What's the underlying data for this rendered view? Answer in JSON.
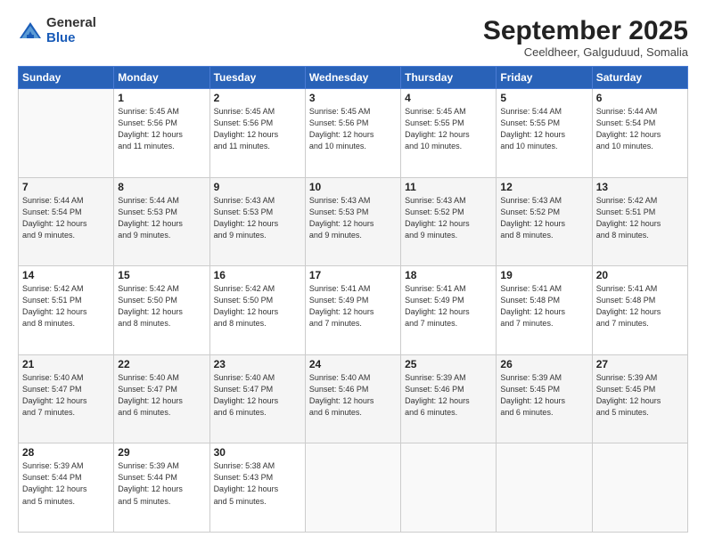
{
  "header": {
    "logo_general": "General",
    "logo_blue": "Blue",
    "month_title": "September 2025",
    "subtitle": "Ceeldheer, Galguduud, Somalia"
  },
  "weekdays": [
    "Sunday",
    "Monday",
    "Tuesday",
    "Wednesday",
    "Thursday",
    "Friday",
    "Saturday"
  ],
  "weeks": [
    [
      {
        "day": "",
        "info": ""
      },
      {
        "day": "1",
        "info": "Sunrise: 5:45 AM\nSunset: 5:56 PM\nDaylight: 12 hours\nand 11 minutes."
      },
      {
        "day": "2",
        "info": "Sunrise: 5:45 AM\nSunset: 5:56 PM\nDaylight: 12 hours\nand 11 minutes."
      },
      {
        "day": "3",
        "info": "Sunrise: 5:45 AM\nSunset: 5:56 PM\nDaylight: 12 hours\nand 10 minutes."
      },
      {
        "day": "4",
        "info": "Sunrise: 5:45 AM\nSunset: 5:55 PM\nDaylight: 12 hours\nand 10 minutes."
      },
      {
        "day": "5",
        "info": "Sunrise: 5:44 AM\nSunset: 5:55 PM\nDaylight: 12 hours\nand 10 minutes."
      },
      {
        "day": "6",
        "info": "Sunrise: 5:44 AM\nSunset: 5:54 PM\nDaylight: 12 hours\nand 10 minutes."
      }
    ],
    [
      {
        "day": "7",
        "info": "Sunrise: 5:44 AM\nSunset: 5:54 PM\nDaylight: 12 hours\nand 9 minutes."
      },
      {
        "day": "8",
        "info": "Sunrise: 5:44 AM\nSunset: 5:53 PM\nDaylight: 12 hours\nand 9 minutes."
      },
      {
        "day": "9",
        "info": "Sunrise: 5:43 AM\nSunset: 5:53 PM\nDaylight: 12 hours\nand 9 minutes."
      },
      {
        "day": "10",
        "info": "Sunrise: 5:43 AM\nSunset: 5:53 PM\nDaylight: 12 hours\nand 9 minutes."
      },
      {
        "day": "11",
        "info": "Sunrise: 5:43 AM\nSunset: 5:52 PM\nDaylight: 12 hours\nand 9 minutes."
      },
      {
        "day": "12",
        "info": "Sunrise: 5:43 AM\nSunset: 5:52 PM\nDaylight: 12 hours\nand 8 minutes."
      },
      {
        "day": "13",
        "info": "Sunrise: 5:42 AM\nSunset: 5:51 PM\nDaylight: 12 hours\nand 8 minutes."
      }
    ],
    [
      {
        "day": "14",
        "info": "Sunrise: 5:42 AM\nSunset: 5:51 PM\nDaylight: 12 hours\nand 8 minutes."
      },
      {
        "day": "15",
        "info": "Sunrise: 5:42 AM\nSunset: 5:50 PM\nDaylight: 12 hours\nand 8 minutes."
      },
      {
        "day": "16",
        "info": "Sunrise: 5:42 AM\nSunset: 5:50 PM\nDaylight: 12 hours\nand 8 minutes."
      },
      {
        "day": "17",
        "info": "Sunrise: 5:41 AM\nSunset: 5:49 PM\nDaylight: 12 hours\nand 7 minutes."
      },
      {
        "day": "18",
        "info": "Sunrise: 5:41 AM\nSunset: 5:49 PM\nDaylight: 12 hours\nand 7 minutes."
      },
      {
        "day": "19",
        "info": "Sunrise: 5:41 AM\nSunset: 5:48 PM\nDaylight: 12 hours\nand 7 minutes."
      },
      {
        "day": "20",
        "info": "Sunrise: 5:41 AM\nSunset: 5:48 PM\nDaylight: 12 hours\nand 7 minutes."
      }
    ],
    [
      {
        "day": "21",
        "info": "Sunrise: 5:40 AM\nSunset: 5:47 PM\nDaylight: 12 hours\nand 7 minutes."
      },
      {
        "day": "22",
        "info": "Sunrise: 5:40 AM\nSunset: 5:47 PM\nDaylight: 12 hours\nand 6 minutes."
      },
      {
        "day": "23",
        "info": "Sunrise: 5:40 AM\nSunset: 5:47 PM\nDaylight: 12 hours\nand 6 minutes."
      },
      {
        "day": "24",
        "info": "Sunrise: 5:40 AM\nSunset: 5:46 PM\nDaylight: 12 hours\nand 6 minutes."
      },
      {
        "day": "25",
        "info": "Sunrise: 5:39 AM\nSunset: 5:46 PM\nDaylight: 12 hours\nand 6 minutes."
      },
      {
        "day": "26",
        "info": "Sunrise: 5:39 AM\nSunset: 5:45 PM\nDaylight: 12 hours\nand 6 minutes."
      },
      {
        "day": "27",
        "info": "Sunrise: 5:39 AM\nSunset: 5:45 PM\nDaylight: 12 hours\nand 5 minutes."
      }
    ],
    [
      {
        "day": "28",
        "info": "Sunrise: 5:39 AM\nSunset: 5:44 PM\nDaylight: 12 hours\nand 5 minutes."
      },
      {
        "day": "29",
        "info": "Sunrise: 5:39 AM\nSunset: 5:44 PM\nDaylight: 12 hours\nand 5 minutes."
      },
      {
        "day": "30",
        "info": "Sunrise: 5:38 AM\nSunset: 5:43 PM\nDaylight: 12 hours\nand 5 minutes."
      },
      {
        "day": "",
        "info": ""
      },
      {
        "day": "",
        "info": ""
      },
      {
        "day": "",
        "info": ""
      },
      {
        "day": "",
        "info": ""
      }
    ]
  ]
}
